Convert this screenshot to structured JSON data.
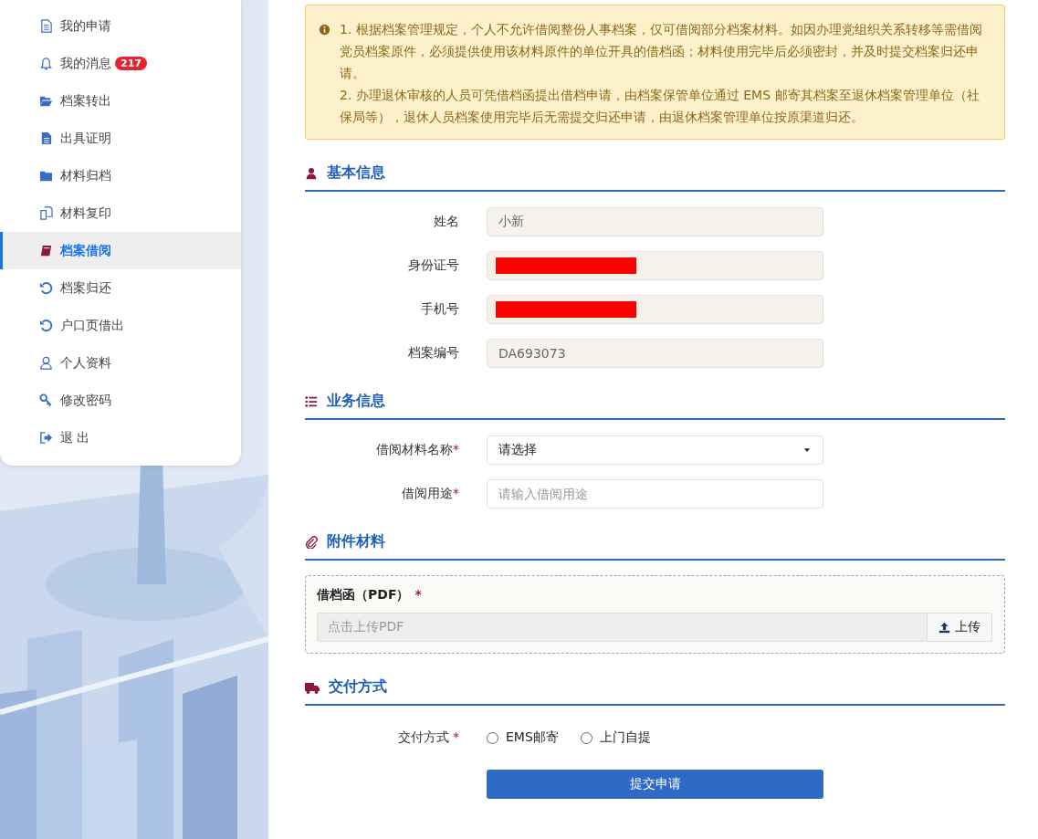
{
  "sidebar": {
    "items": [
      {
        "label": "我的申请",
        "selected": false
      },
      {
        "label": "我的消息",
        "badge": "217",
        "selected": false
      },
      {
        "label": "档案转出",
        "selected": false
      },
      {
        "label": "出具证明",
        "selected": false
      },
      {
        "label": "材料归档",
        "selected": false
      },
      {
        "label": "材料复印",
        "selected": false
      },
      {
        "label": "档案借阅",
        "selected": true
      },
      {
        "label": "档案归还",
        "selected": false
      },
      {
        "label": "户口页借出",
        "selected": false
      },
      {
        "label": "个人资料",
        "selected": false
      },
      {
        "label": "修改密码",
        "selected": false
      },
      {
        "label": "退 出",
        "selected": false
      }
    ]
  },
  "notice": {
    "paragraphs": [
      "1. 根据档案管理规定，个人不允许借阅整份人事档案，仅可借阅部分档案材料。如因办理党组织关系转移等需借阅党员档案原件，必须提供使用该材料原件的单位开具的借档函；材料使用完毕后必须密封，并及时提交档案归还申请。",
      "2. 办理退休审核的人员可凭借档函提出借档申请，由档案保管单位通过 EMS 邮寄其档案至退休档案管理单位（社保局等），退休人员档案使用完毕后无需提交归还申请，由退休档案管理单位按原渠道归还。"
    ]
  },
  "sections": [
    {
      "kind": "info",
      "title": "基本信息",
      "fields": [
        {
          "label": "姓名",
          "value": "小新",
          "redacted": false
        },
        {
          "label": "身份证号",
          "redacted": true
        },
        {
          "label": "手机号",
          "redacted": true
        },
        {
          "label": "档案编号",
          "value": "DA693073",
          "redacted": false
        }
      ]
    },
    {
      "kind": "form",
      "title": "业务信息",
      "fields": [
        {
          "kind": "select",
          "label": "借阅材料名称",
          "required_mark": "*",
          "value": "请选择"
        },
        {
          "kind": "text",
          "label": "借阅用途",
          "required_mark": "*",
          "placeholder": "请输入借阅用途"
        }
      ]
    },
    {
      "kind": "attachment",
      "title": "附件材料",
      "items": [
        {
          "label": "借档函（PDF）",
          "required_mark": "*",
          "placeholder": "点击上传PDF",
          "button": "上传"
        }
      ]
    },
    {
      "kind": "delivery",
      "title": "交付方式",
      "label": "交付方式",
      "required_mark": "*",
      "options": [
        {
          "label": "EMS邮寄",
          "selected": false
        },
        {
          "label": "上门自提",
          "selected": false
        }
      ]
    }
  ],
  "submit": "提交申请"
}
